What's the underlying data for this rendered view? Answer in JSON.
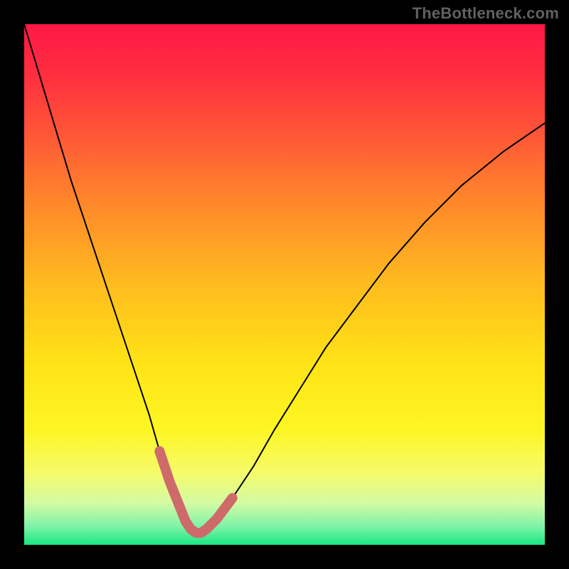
{
  "watermark": "TheBottleneck.com",
  "colors": {
    "page_bg": "#000000",
    "curve": "#000000",
    "highlight": "#cf6a6b",
    "gradient_stops": [
      {
        "offset": 0.0,
        "color": "#ff1846"
      },
      {
        "offset": 0.1,
        "color": "#ff2f3f"
      },
      {
        "offset": 0.22,
        "color": "#ff5a36"
      },
      {
        "offset": 0.35,
        "color": "#ff8a2a"
      },
      {
        "offset": 0.5,
        "color": "#ffbc1e"
      },
      {
        "offset": 0.65,
        "color": "#ffe316"
      },
      {
        "offset": 0.78,
        "color": "#fdf623"
      },
      {
        "offset": 0.86,
        "color": "#f6fb6a"
      },
      {
        "offset": 0.92,
        "color": "#d3fba3"
      },
      {
        "offset": 0.965,
        "color": "#7df3a8"
      },
      {
        "offset": 1.0,
        "color": "#18e880"
      }
    ]
  },
  "chart_data": {
    "type": "line",
    "title": "",
    "xlabel": "",
    "ylabel": "",
    "xlim": [
      0,
      100
    ],
    "ylim": [
      0,
      100
    ],
    "series": [
      {
        "name": "bottleneck_curve",
        "x": [
          0,
          3,
          6,
          9,
          12,
          15,
          18,
          21,
          24,
          26,
          28,
          30,
          31,
          32,
          33,
          34,
          35,
          37,
          40,
          44,
          48,
          53,
          58,
          64,
          70,
          77,
          84,
          92,
          100
        ],
        "y": [
          100,
          90,
          80,
          70,
          61,
          52,
          43,
          34,
          25,
          18,
          12,
          7,
          4.5,
          3.0,
          2.3,
          2.3,
          3.0,
          5.0,
          9,
          15,
          22,
          30,
          38,
          46,
          54,
          62,
          69,
          75.5,
          81
        ]
      }
    ],
    "highlight_range": {
      "x": [
        26,
        28,
        30,
        31,
        32,
        33,
        34,
        35,
        37,
        40
      ],
      "y": [
        18,
        12,
        7,
        4.5,
        3.0,
        2.3,
        2.3,
        3.0,
        5.0,
        9
      ]
    },
    "highlight_stroke_width_px": 14
  }
}
